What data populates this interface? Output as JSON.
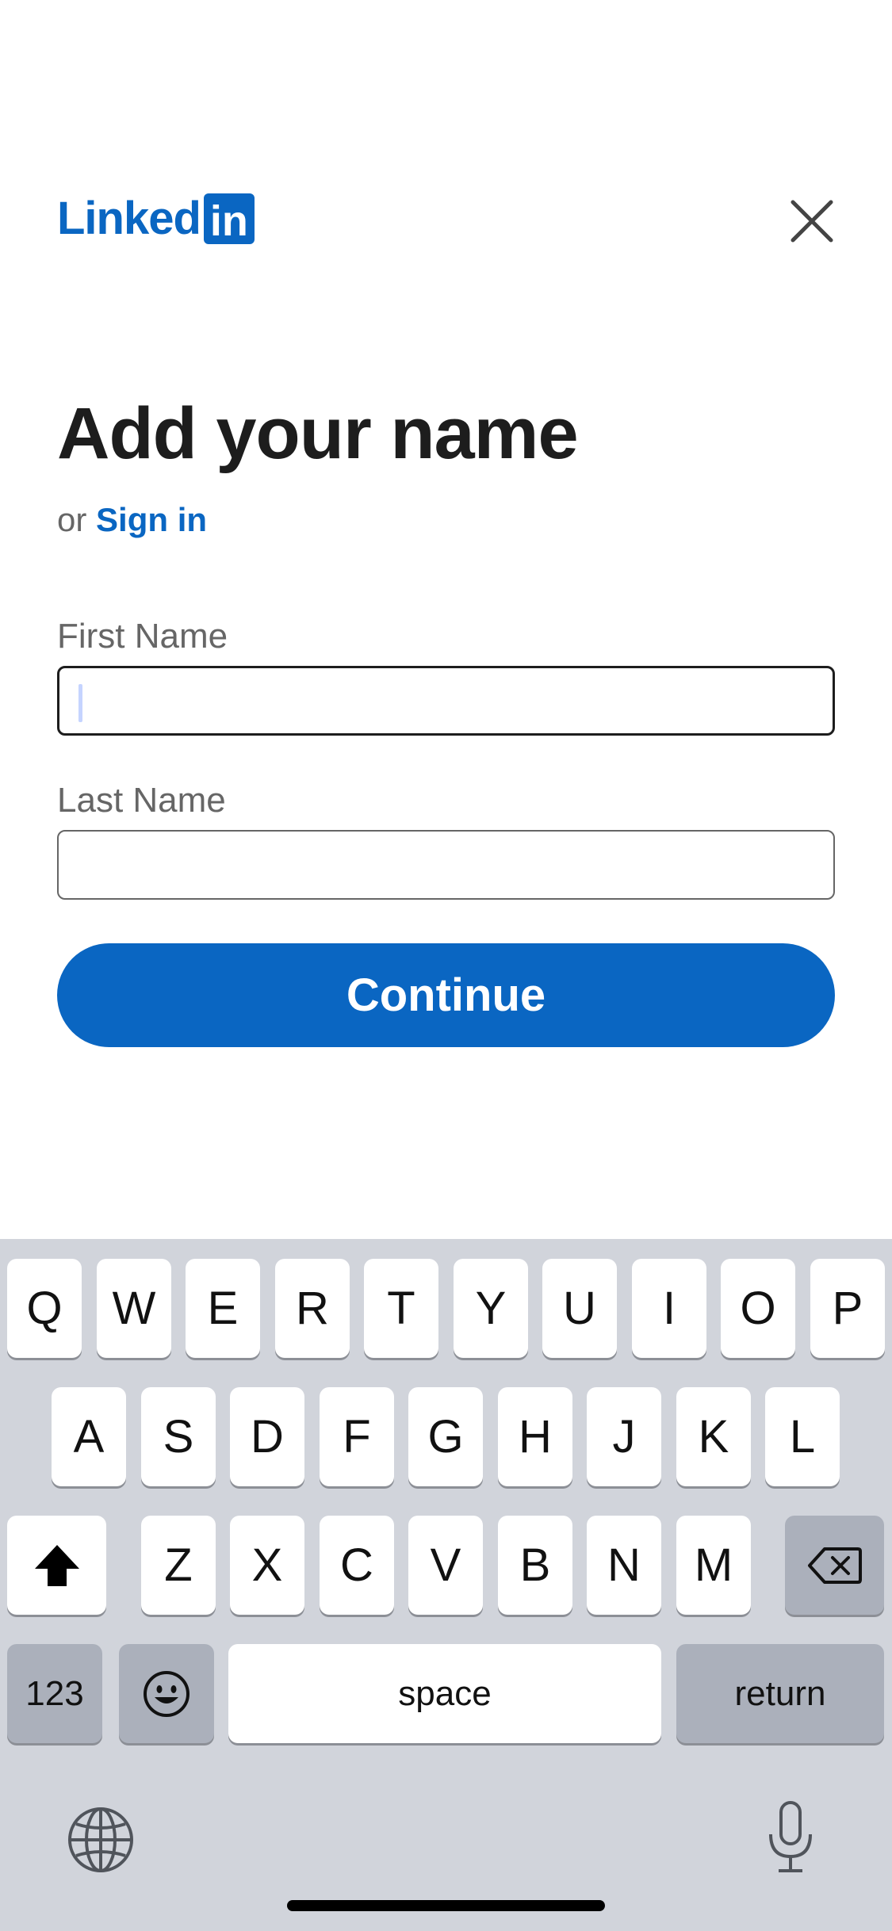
{
  "header": {
    "logo_word": "Linked",
    "logo_box": "in",
    "brand_color": "#0a66c2",
    "close_icon": "close-icon"
  },
  "form": {
    "title": "Add your name",
    "or_text": "or",
    "signin_label": "Sign in",
    "first_name_label": "First Name",
    "first_name_value": "",
    "last_name_label": "Last Name",
    "last_name_value": "",
    "continue_label": "Continue"
  },
  "keyboard": {
    "row1": [
      "Q",
      "W",
      "E",
      "R",
      "T",
      "Y",
      "U",
      "I",
      "O",
      "P"
    ],
    "row2": [
      "A",
      "S",
      "D",
      "F",
      "G",
      "H",
      "J",
      "K",
      "L"
    ],
    "row3": [
      "Z",
      "X",
      "C",
      "V",
      "B",
      "N",
      "M"
    ],
    "numbers_label": "123",
    "space_label": "space",
    "return_label": "return",
    "shift_icon": "shift-icon",
    "backspace_icon": "backspace-icon",
    "emoji_icon": "emoji-icon",
    "globe_icon": "globe-icon",
    "mic_icon": "microphone-icon"
  }
}
